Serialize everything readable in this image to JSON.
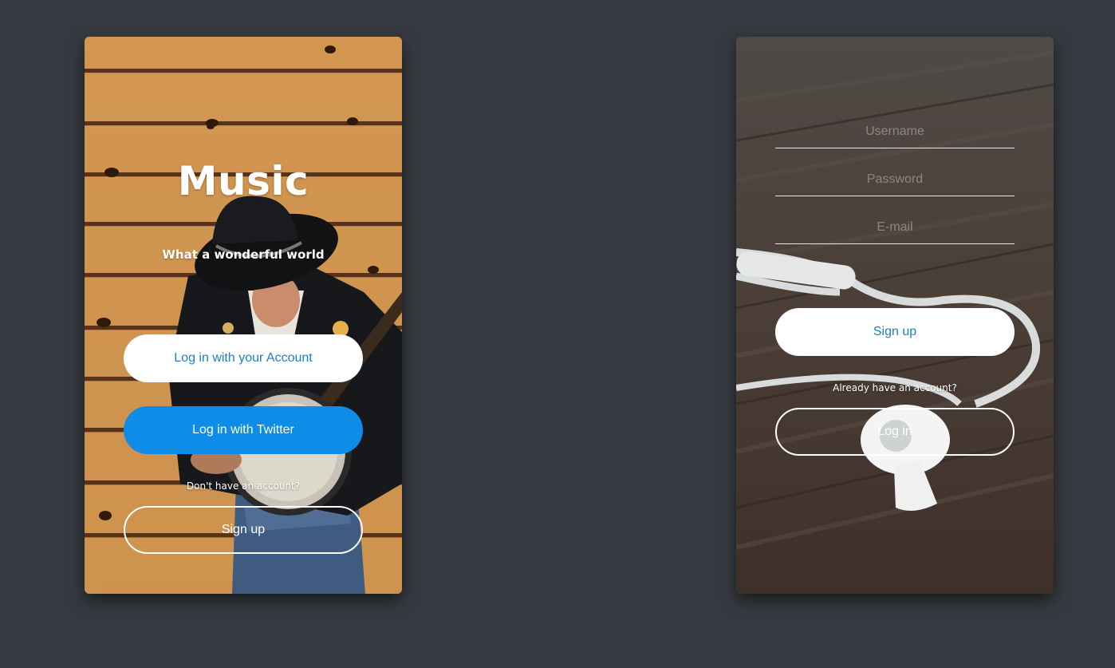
{
  "left_card": {
    "title": "Music",
    "subtitle": "What a wonderful world",
    "account_button": "Log in with your Account",
    "twitter_button": "Log in with Twitter",
    "no_account_text": "Don't have an account?",
    "signup_button": "Sign up"
  },
  "right_card": {
    "username_placeholder": "Username",
    "password_placeholder": "Password",
    "email_placeholder": "E-mail",
    "signup_button": "Sign up",
    "have_account_text": "Already have an account?",
    "login_button": "Log in"
  },
  "colors": {
    "page_background": "#363a40",
    "twitter_blue": "#0e8ce8",
    "link_blue": "#1d7fc4"
  }
}
